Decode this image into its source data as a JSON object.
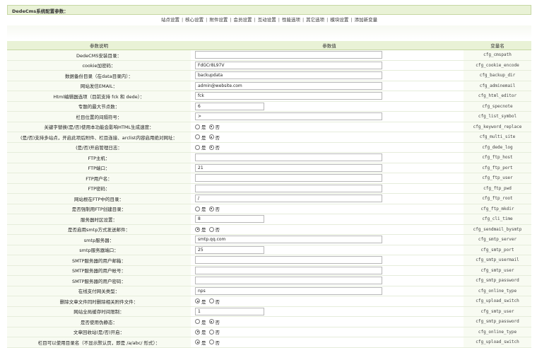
{
  "header": {
    "title": "DedeCms系统配置参数："
  },
  "tabs": [
    "站点设置",
    "核心设置",
    "附件设置",
    "会员设置",
    "互动设置",
    "性能选项",
    "其它选项",
    "模块设置",
    "添加新变量"
  ],
  "table": {
    "headers": [
      "参数说明",
      "参数值",
      "变量名"
    ],
    "rows": [
      {
        "desc": "DedeCMS安装目录：",
        "type": "text",
        "value": "",
        "var": "cfg_cmspath"
      },
      {
        "desc": "cookie加密码：",
        "type": "text",
        "value": "FdGCr8L97V",
        "var": "cfg_cookie_encode"
      },
      {
        "desc": "数据备份目录（在data目录内）：",
        "type": "text",
        "value": "backupdata",
        "var": "cfg_backup_dir"
      },
      {
        "desc": "网站发信EMAIL：",
        "type": "text",
        "value": "admin@website.com",
        "var": "cfg_adminemail"
      },
      {
        "desc": "Html编辑器选项（目前支持 fck 和 dede）：",
        "type": "text",
        "value": "fck",
        "var": "cfg_html_editor"
      },
      {
        "desc": "专题的最大节点数：",
        "type": "short",
        "value": "6",
        "var": "cfg_specnote"
      },
      {
        "desc": "栏目位置的间隔符号：",
        "type": "text",
        "value": ">",
        "var": "cfg_list_symbol"
      },
      {
        "desc": "关键字替换(是/否)使用本功能会影响HTML生成速度：",
        "type": "radio",
        "options": [
          "是",
          "否"
        ],
        "selected": 1,
        "var": "cfg_keyword_replace"
      },
      {
        "desc": "(是/否)支持多站点，开启此项后附件、栏目连接、arclist内容启用绝对网址：",
        "type": "radio",
        "options": [
          "是",
          "否"
        ],
        "selected": 1,
        "var": "cfg_multi_site"
      },
      {
        "desc": "(是/否)开启管理日志：",
        "type": "radio",
        "options": [
          "是",
          "否"
        ],
        "selected": 1,
        "var": "cfg_dede_log"
      },
      {
        "desc": "FTP主机：",
        "type": "text",
        "value": "",
        "var": "cfg_ftp_host"
      },
      {
        "desc": "FTP端口：",
        "type": "text",
        "value": "21",
        "var": "cfg_ftp_port"
      },
      {
        "desc": "FTP用户名：",
        "type": "text",
        "value": "",
        "var": "cfg_ftp_user"
      },
      {
        "desc": "FTP密码：",
        "type": "text",
        "value": "",
        "var": "cfg_ftp_pwd"
      },
      {
        "desc": "网站根在FTP中的目录：",
        "type": "text",
        "value": "/",
        "var": "cfg_ftp_root"
      },
      {
        "desc": "是否强制用FTP创建目录：",
        "type": "radio",
        "options": [
          "是",
          "否"
        ],
        "selected": 1,
        "var": "cfg_ftp_mkdir"
      },
      {
        "desc": "服务器时区设置：",
        "type": "short",
        "value": "8",
        "var": "cfg_cli_time"
      },
      {
        "desc": "是否启用smtp方式发送邮件：",
        "type": "radio",
        "options": [
          "是",
          "否"
        ],
        "selected": 0,
        "var": "cfg_sendmail_bysmtp"
      },
      {
        "desc": "smtp服务器：",
        "type": "text",
        "value": "smtp.qq.com",
        "var": "cfg_smtp_server"
      },
      {
        "desc": "smtp服务器端口：",
        "type": "short",
        "value": "25",
        "var": "cfg_smtp_port"
      },
      {
        "desc": "SMTP服务器的用户邮箱：",
        "type": "text",
        "value": "",
        "var": "cfg_smtp_usermail"
      },
      {
        "desc": "SMTP服务器的用户帐号：",
        "type": "text",
        "value": "",
        "var": "cfg_smtp_user"
      },
      {
        "desc": "SMTP服务器的用户密码：",
        "type": "text",
        "value": "",
        "var": "cfg_smtp_password"
      },
      {
        "desc": "在线支付网关类型：",
        "type": "text",
        "value": "nps",
        "var": "cfg_online_type"
      },
      {
        "desc": "删除文章文件同时删除相关附件文件：",
        "type": "radio",
        "options": [
          "是",
          "否"
        ],
        "selected": 0,
        "var": "cfg_upload_switch"
      },
      {
        "desc": "网站全局缓存时间限制：",
        "type": "short",
        "value": "1",
        "var": "cfg_smtp_user"
      },
      {
        "desc": "是否使用伪静态：",
        "type": "radio",
        "options": [
          "是",
          "否"
        ],
        "selected": 1,
        "var": "cfg_smtp_password"
      },
      {
        "desc": "文章回收站(是/否)开启：",
        "type": "radio",
        "options": [
          "是",
          "否"
        ],
        "selected": 0,
        "var": "cfg_online_type"
      },
      {
        "desc": "栏目可以使用目录名（不显示默认页，即是 /a/abc/ 形式）：",
        "type": "radio",
        "options": [
          "是",
          "否"
        ],
        "selected": 0,
        "var": "cfg_upload_switch"
      }
    ]
  }
}
